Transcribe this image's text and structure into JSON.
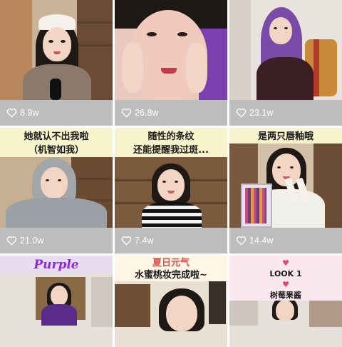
{
  "feed": {
    "items": [
      {
        "likes": "8.9w",
        "caption_lines": []
      },
      {
        "likes": "26.8w",
        "caption_lines": []
      },
      {
        "likes": "23.1w",
        "caption_lines": []
      },
      {
        "likes": "21.0w",
        "caption_lines": [
          "她就认不出我啦",
          "（机智如我）"
        ]
      },
      {
        "likes": "7.4w",
        "caption_lines": [
          "随性的条纹",
          "还能提醒我过斑..."
        ]
      },
      {
        "likes": "14.4w",
        "caption_lines": [
          "是两只唇釉哦"
        ]
      },
      {
        "likes": "",
        "caption_lines": [
          "Purple"
        ]
      },
      {
        "likes": "",
        "caption_lines": [
          "夏日元气",
          "水蜜桃妆完成啦~"
        ]
      },
      {
        "likes": "",
        "caption_lines": [
          "LOOK 1",
          "树莓果酱"
        ]
      }
    ]
  },
  "icons": {
    "like": "heart-outline-icon"
  },
  "colors": {
    "like_bar": "#bdbdbd",
    "caption_bg": "#f7f3cc",
    "purple_title": "#8a2be2"
  }
}
